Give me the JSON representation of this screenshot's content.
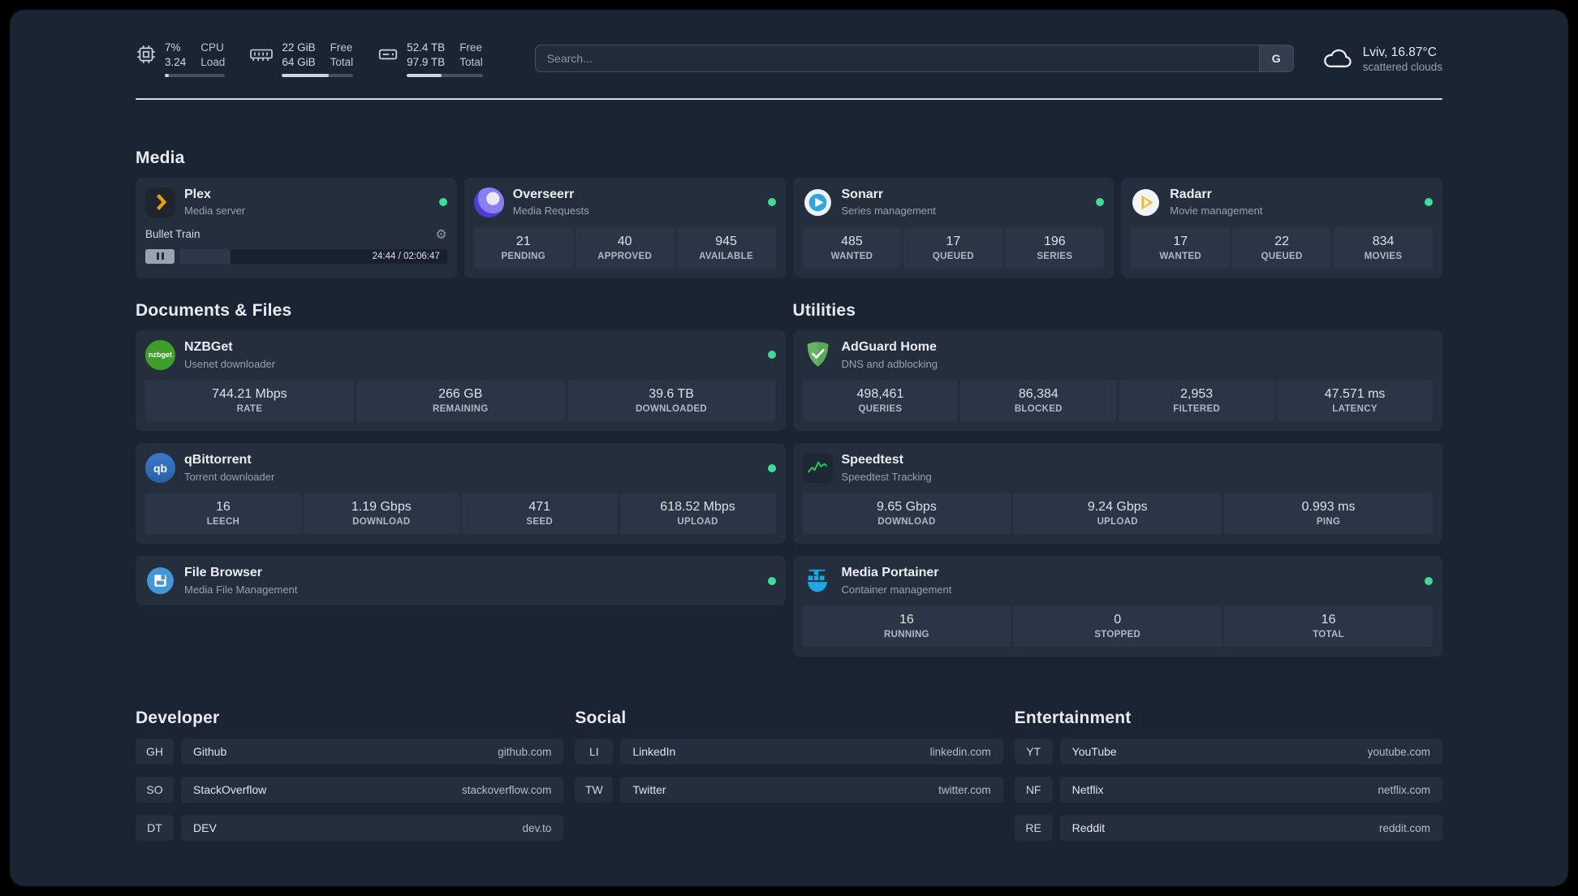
{
  "icons": {
    "gear": "⚙",
    "search_provider": "G",
    "qb_label": "qb",
    "nzbget_label": "nzbget"
  },
  "colors": {
    "status_online": "#3ddc97",
    "background": "#1b2433",
    "card": "#252e3d",
    "plex_accent": "#e5a00d"
  },
  "topbar": {
    "cpu": {
      "icon": "cpu-icon",
      "v1": "7%",
      "l1": "CPU",
      "v2": "3.24",
      "l2": "Load",
      "progress": 7
    },
    "memory": {
      "icon": "memory-icon",
      "v1": "22 GiB",
      "l1": "Free",
      "v2": "64 GiB",
      "l2": "Total",
      "progress": 66
    },
    "disk": {
      "icon": "disk-icon",
      "v1": "52.4 TB",
      "l1": "Free",
      "v2": "97.9 TB",
      "l2": "Total",
      "progress": 46
    },
    "search": {
      "placeholder": "Search...",
      "provider_label": "G"
    },
    "weather": {
      "location": "Lviv, 16.87°C",
      "condition": "scattered clouds"
    }
  },
  "media": {
    "title": "Media",
    "plex": {
      "name": "Plex",
      "desc": "Media server",
      "status": "online",
      "now_playing": "Bullet Train",
      "time": "24:44 / 02:06:47",
      "progress": 19
    },
    "overseerr": {
      "name": "Overseerr",
      "desc": "Media Requests",
      "status": "online",
      "stats": [
        {
          "value": "21",
          "label": "PENDING"
        },
        {
          "value": "40",
          "label": "APPROVED"
        },
        {
          "value": "945",
          "label": "AVAILABLE"
        }
      ]
    },
    "sonarr": {
      "name": "Sonarr",
      "desc": "Series management",
      "status": "online",
      "stats": [
        {
          "value": "485",
          "label": "WANTED"
        },
        {
          "value": "17",
          "label": "QUEUED"
        },
        {
          "value": "196",
          "label": "SERIES"
        }
      ]
    },
    "radarr": {
      "name": "Radarr",
      "desc": "Movie management",
      "status": "online",
      "stats": [
        {
          "value": "17",
          "label": "WANTED"
        },
        {
          "value": "22",
          "label": "QUEUED"
        },
        {
          "value": "834",
          "label": "MOVIES"
        }
      ]
    }
  },
  "documents": {
    "title": "Documents & Files",
    "nzbget": {
      "name": "NZBGet",
      "desc": "Usenet downloader",
      "status": "online",
      "stats": [
        {
          "value": "744.21 Mbps",
          "label": "RATE"
        },
        {
          "value": "266 GB",
          "label": "REMAINING"
        },
        {
          "value": "39.6 TB",
          "label": "DOWNLOADED"
        }
      ]
    },
    "qbittorrent": {
      "name": "qBittorrent",
      "desc": "Torrent downloader",
      "status": "online",
      "stats": [
        {
          "value": "16",
          "label": "LEECH"
        },
        {
          "value": "1.19 Gbps",
          "label": "DOWNLOAD"
        },
        {
          "value": "471",
          "label": "SEED"
        },
        {
          "value": "618.52 Mbps",
          "label": "UPLOAD"
        }
      ]
    },
    "filebrowser": {
      "name": "File Browser",
      "desc": "Media File Management",
      "status": "online"
    }
  },
  "utilities": {
    "title": "Utilities",
    "adguard": {
      "name": "AdGuard Home",
      "desc": "DNS and adblocking",
      "stats": [
        {
          "value": "498,461",
          "label": "QUERIES"
        },
        {
          "value": "86,384",
          "label": "BLOCKED"
        },
        {
          "value": "2,953",
          "label": "FILTERED"
        },
        {
          "value": "47.571 ms",
          "label": "LATENCY"
        }
      ]
    },
    "speedtest": {
      "name": "Speedtest",
      "desc": "Speedtest Tracking",
      "stats": [
        {
          "value": "9.65 Gbps",
          "label": "DOWNLOAD"
        },
        {
          "value": "9.24 Gbps",
          "label": "UPLOAD"
        },
        {
          "value": "0.993 ms",
          "label": "PING"
        }
      ]
    },
    "portainer": {
      "name": "Media Portainer",
      "desc": "Container management",
      "status": "online",
      "stats": [
        {
          "value": "16",
          "label": "RUNNING"
        },
        {
          "value": "0",
          "label": "STOPPED"
        },
        {
          "value": "16",
          "label": "TOTAL"
        }
      ]
    }
  },
  "bookmarks": [
    {
      "title": "Developer",
      "items": [
        {
          "abbr": "GH",
          "name": "Github",
          "url": "github.com"
        },
        {
          "abbr": "SO",
          "name": "StackOverflow",
          "url": "stackoverflow.com"
        },
        {
          "abbr": "DT",
          "name": "DEV",
          "url": "dev.to"
        }
      ]
    },
    {
      "title": "Social",
      "items": [
        {
          "abbr": "LI",
          "name": "LinkedIn",
          "url": "linkedin.com"
        },
        {
          "abbr": "TW",
          "name": "Twitter",
          "url": "twitter.com"
        }
      ]
    },
    {
      "title": "Entertainment",
      "items": [
        {
          "abbr": "YT",
          "name": "YouTube",
          "url": "youtube.com"
        },
        {
          "abbr": "NF",
          "name": "Netflix",
          "url": "netflix.com"
        },
        {
          "abbr": "RE",
          "name": "Reddit",
          "url": "reddit.com"
        }
      ]
    }
  ]
}
